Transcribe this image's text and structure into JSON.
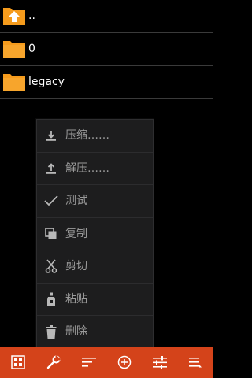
{
  "files": [
    {
      "name": "..",
      "icon": "folder-up-icon"
    },
    {
      "name": "0",
      "icon": "folder-icon"
    },
    {
      "name": "legacy",
      "icon": "folder-icon"
    }
  ],
  "context_menu": {
    "items": [
      {
        "label": "压缩……",
        "icon": "download-icon"
      },
      {
        "label": "解压……",
        "icon": "upload-icon"
      },
      {
        "label": "测试",
        "icon": "checkmark-icon"
      },
      {
        "label": "复制",
        "icon": "copy-icon"
      },
      {
        "label": "剪切",
        "icon": "scissors-icon"
      },
      {
        "label": "粘贴",
        "icon": "paste-icon"
      },
      {
        "label": "删除",
        "icon": "trash-icon"
      }
    ]
  },
  "toolbar": {
    "buttons": [
      "select-grid-icon",
      "tools-icon",
      "sort-icon",
      "add-icon",
      "settings-icon",
      "menu-icon"
    ]
  },
  "colors": {
    "toolbar": "#d4431a",
    "folder": "#f59b1c",
    "menu_bg": "#1d1d1e",
    "menu_text": "#9a9a9a"
  }
}
